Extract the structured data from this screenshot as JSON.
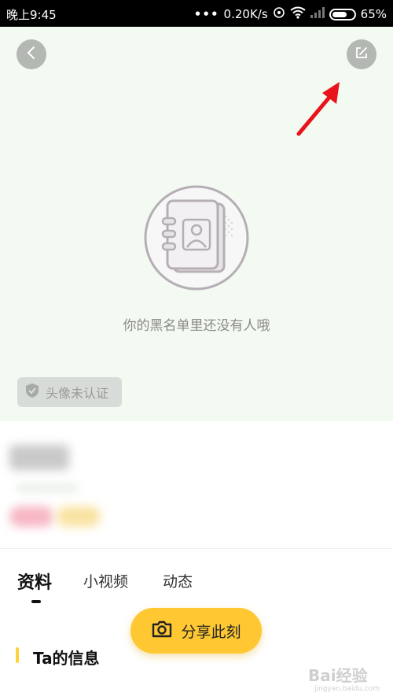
{
  "status_bar": {
    "time": "晚上9:45",
    "network_speed": "0.20K/s",
    "battery_percent": "65%",
    "icons": [
      "more-dots-icon",
      "sync-icon",
      "wifi-icon",
      "signal-icon",
      "battery-icon"
    ]
  },
  "header": {
    "back_icon": "chevron-left-icon",
    "edit_icon": "edit-icon"
  },
  "empty_state": {
    "icon": "contacts-book-icon",
    "message": "你的黑名单里还没有人哦"
  },
  "avatar_badge": {
    "icon": "shield-icon",
    "label": "头像未认证"
  },
  "tabs": [
    {
      "label": "资料",
      "active": true
    },
    {
      "label": "小视频",
      "active": false
    },
    {
      "label": "动态",
      "active": false
    }
  ],
  "section": {
    "title": "Ta的信息"
  },
  "share_button": {
    "icon": "camera-icon",
    "label": "分享此刻"
  },
  "watermark": {
    "text": "Bai经验",
    "sub": "jingyan.baidu.com"
  },
  "colors": {
    "header_bg": "#f3faf1",
    "accent_yellow": "#ffc832",
    "arrow_red": "#e8141c"
  }
}
